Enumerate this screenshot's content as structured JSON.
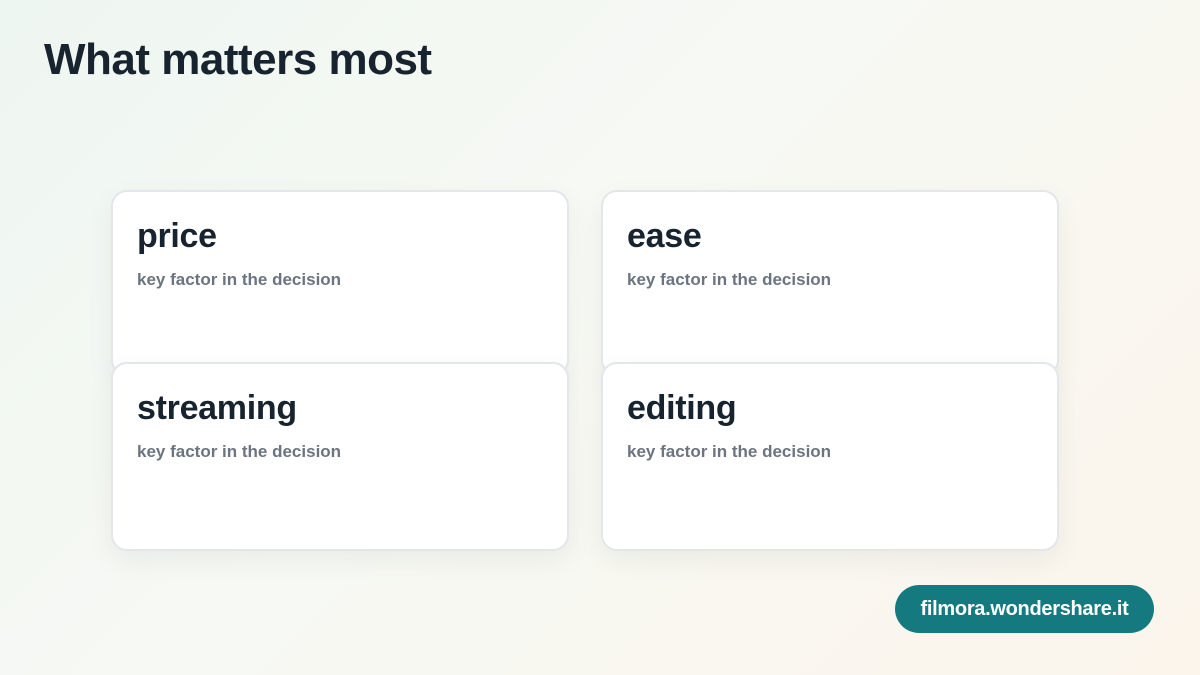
{
  "page": {
    "title": "What matters most"
  },
  "cards": [
    {
      "title": "price",
      "subtitle": "key factor in the decision"
    },
    {
      "title": "ease",
      "subtitle": "key factor in the decision"
    },
    {
      "title": "streaming",
      "subtitle": "key factor in the decision"
    },
    {
      "title": "editing",
      "subtitle": "key factor in the decision"
    }
  ],
  "brand": {
    "label": "filmora.wondershare.it",
    "color": "#157a80"
  }
}
